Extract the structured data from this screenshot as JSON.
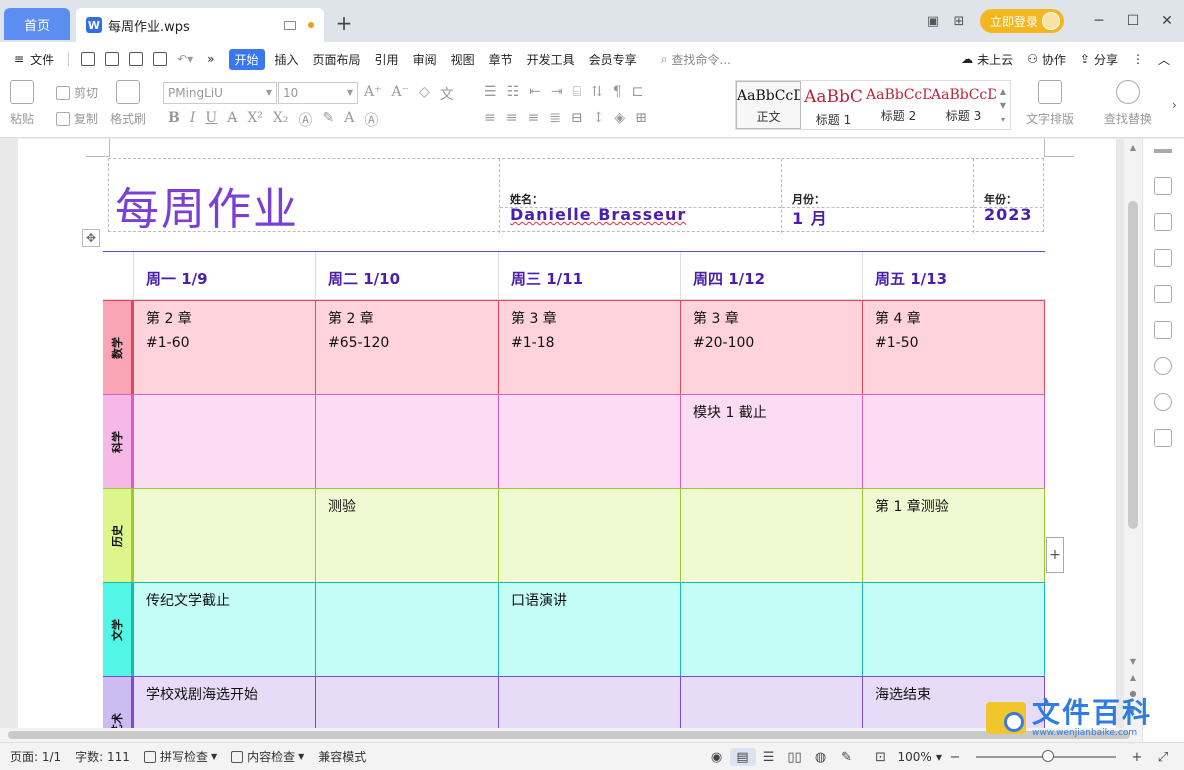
{
  "tabs": {
    "home_label": "首页",
    "doc_name": "每周作业.wps",
    "new_tab": "+"
  },
  "titlebar": {
    "login_label": "立即登录",
    "min": "─",
    "max": "☐",
    "close": "✕"
  },
  "menu": {
    "file": "文件",
    "items": [
      "开始",
      "插入",
      "页面布局",
      "引用",
      "审阅",
      "视图",
      "章节",
      "开发工具",
      "会员专享"
    ],
    "more": "»",
    "search_placeholder": "查找命令...",
    "cloud": "未上云",
    "collab": "协作",
    "share": "分享",
    "more_dots": "⋮",
    "collapse": "︿"
  },
  "ribbon": {
    "paste": "粘贴",
    "cut": "剪切",
    "copy": "复制",
    "format_painter": "格式刷",
    "font_name": "PMingLiU",
    "font_size": "10",
    "bold": "B",
    "italic": "I",
    "underline": "U",
    "styles": [
      {
        "preview": "AaBbCcD",
        "label": "正文",
        "color": "#111111"
      },
      {
        "preview": "AaBbC",
        "label": "标题 1",
        "color": "#c0203a"
      },
      {
        "preview": "AaBbCcD",
        "label": "标题 2",
        "color": "#c0203a"
      },
      {
        "preview": "AaBbCcD",
        "label": "标题 3",
        "color": "#c0203a"
      }
    ],
    "text_layout": "文字排版",
    "find_replace": "查找替换"
  },
  "document": {
    "title": "每周作业",
    "name_label": "姓名：",
    "name_value": "Danielle  Brasseur",
    "month_label": "月份：",
    "month_value": "1 月",
    "year_label": "年份：",
    "year_value": "2023",
    "days": [
      "周一 1/9",
      "周二 1/10",
      "周三 1/11",
      "周四 1/12",
      "周五 1/13"
    ],
    "subjects": [
      {
        "name": "数学",
        "color": "#ffd3dc",
        "accent": "#f9a5b6",
        "line": "#e6455e",
        "cells": [
          "第 2 章\n#1-60",
          "第 2 章\n#65-120",
          "第 3 章\n#1-18",
          "第 3 章\n#20-100",
          "第 4 章\n#1-50"
        ]
      },
      {
        "name": "科学",
        "color": "#fbdcf3",
        "accent": "#f6b8e6",
        "line": "#d65fc0",
        "cells": [
          "",
          "",
          "",
          "模块 1 截止",
          ""
        ]
      },
      {
        "name": "历史",
        "color": "#f0fad2",
        "accent": "#dcf58c",
        "line": "#9acb2e",
        "cells": [
          "",
          "测验",
          "",
          "",
          "第 1 章测验"
        ]
      },
      {
        "name": "文学",
        "color": "#c3fdf6",
        "accent": "#53f5e5",
        "line": "#1bb9ab",
        "cells": [
          "传纪文学截止",
          "",
          "口语演讲",
          "",
          ""
        ]
      },
      {
        "name": "艺术",
        "color": "#e6dcf7",
        "accent": "#cdbcf1",
        "line": "#7d4bd0",
        "cells": [
          "学校戏剧海选开始",
          "",
          "",
          "",
          "海选结束"
        ]
      }
    ]
  },
  "statusbar": {
    "page": "页面: 1/1",
    "words": "字数: 111",
    "spell": "拼写检查",
    "content_check": "内容检查",
    "compat": "兼容模式",
    "zoom": "100%"
  },
  "watermark": {
    "text": "文件百科",
    "url": "www.wenjianbaike.com"
  }
}
